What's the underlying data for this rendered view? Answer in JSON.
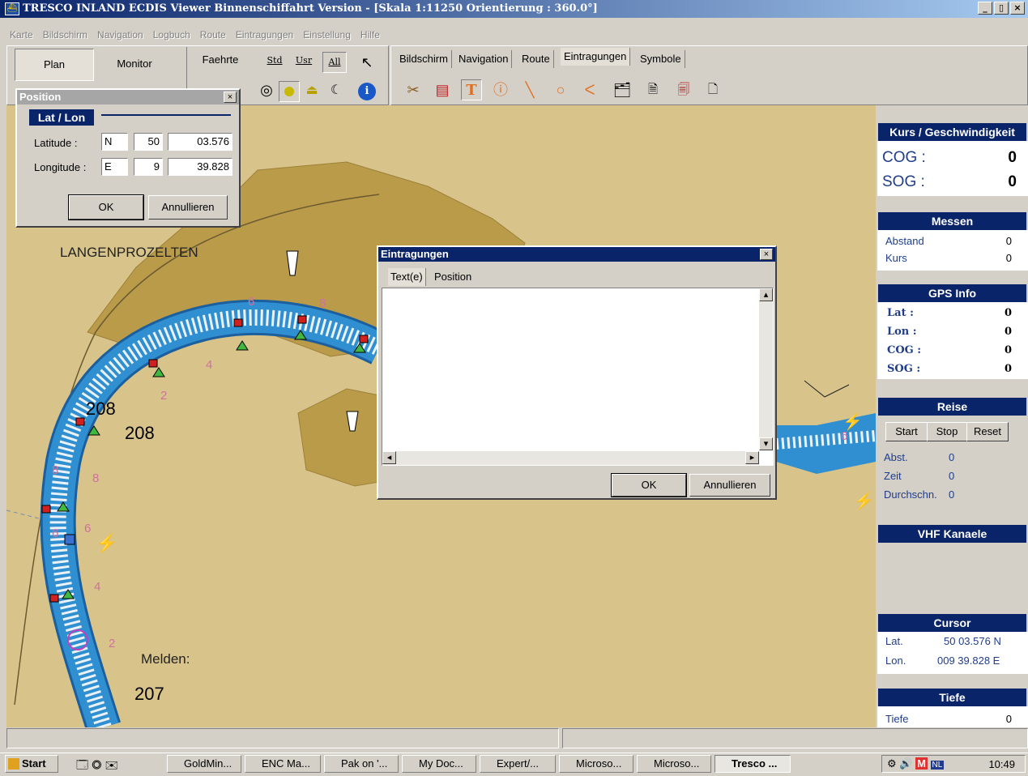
{
  "window": {
    "title": "TRESCO INLAND ECDIS Viewer Binnenschiffahrt Version - [Skala 1:11250 Orientierung : 360.0°]",
    "btn_min": "_",
    "btn_max": "▯",
    "btn_close": "×"
  },
  "menu": [
    "Karte",
    "Bildschirm",
    "Navigation",
    "Logbuch",
    "Route",
    "Eintragungen",
    "Einstellung",
    "Hilfe"
  ],
  "toolbar": {
    "plan": "Plan",
    "monitor": "Monitor",
    "faehrte": "Faehrte",
    "std": "Std",
    "usr": "Usr",
    "all": "All"
  },
  "tabs": [
    "Bildschirm",
    "Navigation",
    "Route",
    "Eintragungen",
    "Symbole"
  ],
  "position_dialog": {
    "title": "Position",
    "section": "Lat / Lon",
    "lat_label": "Latitude :",
    "lon_label": "Longitude :",
    "lat_hem": "N",
    "lat_deg": "50",
    "lat_min": "03.576",
    "lon_hem": "E",
    "lon_deg": "9",
    "lon_min": "39.828",
    "ok": "OK",
    "cancel": "Annullieren"
  },
  "eintragungen_dialog": {
    "title": "Eintragungen",
    "tab1": "Text(e)",
    "tab2": "Position",
    "ok": "OK",
    "cancel": "Annullieren"
  },
  "map": {
    "place1": "LANGENPROZELTEN",
    "place2": "Melden:",
    "km208a": "208",
    "km208b": "208",
    "km207": "207",
    "depth": [
      "6",
      "8",
      "6",
      "8",
      "4",
      "2",
      "8",
      "6",
      "6",
      "4",
      "2"
    ]
  },
  "panel": {
    "kurs": {
      "title": "Kurs /  Geschwindigkeit",
      "cog_label": "COG :",
      "cog": "0",
      "sog_label": "SOG :",
      "sog": "0"
    },
    "messen": {
      "title": "Messen",
      "abstand_label": "Abstand",
      "abstand": "0",
      "kurs_label": "Kurs",
      "kurs": "0"
    },
    "gps": {
      "title": "GPS Info",
      "lat_label": "Lat :",
      "lat": "0",
      "lon_label": "Lon :",
      "lon": "0",
      "cog_label": "COG :",
      "cog": "0",
      "sog_label": "SOG :",
      "sog": "0"
    },
    "reise": {
      "title": "Reise",
      "start": "Start",
      "stop": "Stop",
      "reset": "Reset",
      "abst_label": "Abst.",
      "abst": "0",
      "zeit_label": "Zeit",
      "zeit": "0",
      "durch_label": "Durchschn.",
      "durch": "0"
    },
    "vhf": {
      "title": "VHF Kanaele"
    },
    "cursor": {
      "title": "Cursor",
      "lat_label": "Lat.",
      "lat": "50 03.576 N",
      "lon_label": "Lon.",
      "lon": "009 39.828 E"
    },
    "tiefe": {
      "title": "Tiefe",
      "label": "Tiefe",
      "value": "0"
    }
  },
  "taskbar": {
    "start": "Start",
    "tasks": [
      "GoldMin...",
      "ENC Ma...",
      "Pak on '...",
      "My Doc...",
      "Expert/...",
      "Microso...",
      "Microso...",
      "Tresco ..."
    ],
    "clock": "10:49"
  },
  "colors": {
    "land": "#d8c48a",
    "shore": "#a8883a",
    "water": "#2f8fd0",
    "titlebar": "#0a246a"
  }
}
